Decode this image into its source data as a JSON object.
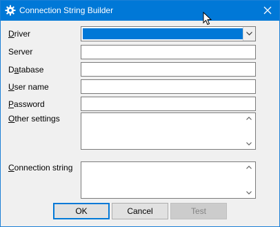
{
  "window": {
    "title": "Connection String Builder"
  },
  "labels": {
    "driver": {
      "mnemonic": "D",
      "rest": "river"
    },
    "server": {
      "mnemonic": "S",
      "rest": "erver"
    },
    "database": {
      "pre": "D",
      "mnemonic": "a",
      "rest": "tabase"
    },
    "username": {
      "mnemonic": "U",
      "rest": "ser name"
    },
    "password": {
      "mnemonic": "P",
      "rest": "assword"
    },
    "other": {
      "mnemonic": "O",
      "rest": "ther settings"
    },
    "connection": {
      "mnemonic": "C",
      "rest": "onnection string"
    }
  },
  "fields": {
    "driver_value": "",
    "server_value": "",
    "database_value": "",
    "username_value": "",
    "password_value": "",
    "other_value": "",
    "connection_value": ""
  },
  "buttons": {
    "ok": "OK",
    "cancel": "Cancel",
    "test": "Test"
  },
  "colors": {
    "titlebar": "#0078d7",
    "selection": "#0078d7"
  }
}
